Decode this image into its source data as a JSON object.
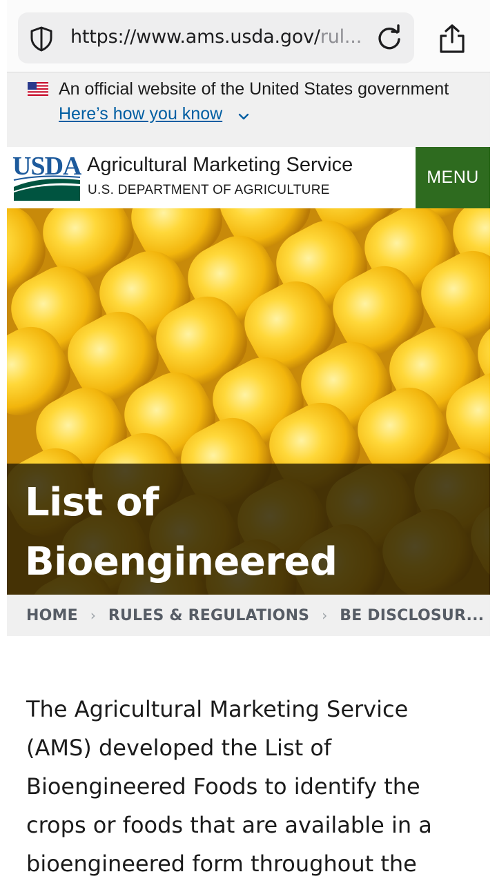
{
  "browser": {
    "url_main": "https://www.ams.usda.gov/",
    "url_dim": "rul...",
    "icons": [
      "shield-icon",
      "reload-icon",
      "share-icon"
    ]
  },
  "gov_banner": {
    "text": "An official website of the United States government",
    "link": "Here’s how you know"
  },
  "header": {
    "logo_text": "USDA",
    "agency": "Agricultural Marketing Service",
    "department": "U.S. DEPARTMENT OF AGRICULTURE",
    "menu_label": "MENU",
    "menu_color": "#2e6b1f"
  },
  "hero": {
    "title": "List of Bioengineered Foods"
  },
  "breadcrumb": {
    "items": [
      "HOME",
      "RULES & REGULATIONS",
      "BE DISCLOSUR..."
    ],
    "separator": "›"
  },
  "body": {
    "paragraph": "The Agricultural Marketing Service (AMS) developed the List of Bioengineered Foods to identify the crops or foods that are available in a bioengineered form throughout the world and for which"
  }
}
